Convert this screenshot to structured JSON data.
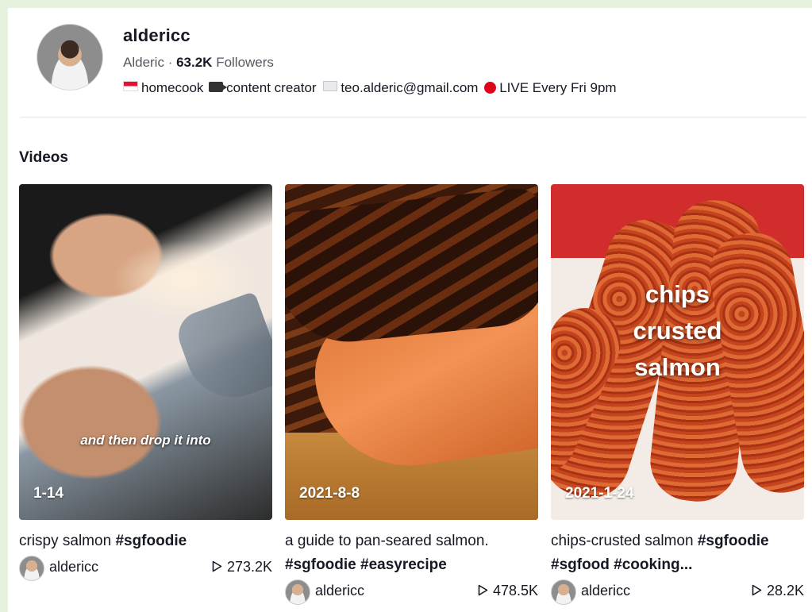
{
  "profile": {
    "username": "aldericc",
    "display_name": "Alderic",
    "separator": " · ",
    "followers_count": "63.2K",
    "followers_label": "Followers",
    "bio": {
      "part1": "homecook",
      "part2": "content creator",
      "part3": "teo.alderic@gmail.com",
      "part4": "LIVE Every Fri 9pm"
    }
  },
  "section_title": "Videos",
  "videos": [
    {
      "date": "1-14",
      "overlay_text": "and then drop it into",
      "title": "crispy salmon",
      "tags": "#sgfoodie",
      "tags2": "",
      "author": "aldericc",
      "views": "273.2K"
    },
    {
      "date": "2021-8-8",
      "overlay_text": "",
      "title": "a guide to pan-seared salmon.",
      "tags": "",
      "tags2": "#sgfoodie #easyrecipe",
      "author": "aldericc",
      "views": "478.5K"
    },
    {
      "date": "2021-1-24",
      "overlay_text": "chips\ncrusted\nsalmon",
      "overlay_line1": "chips",
      "overlay_line2": "crusted",
      "overlay_line3": "salmon",
      "title": "chips-crusted salmon",
      "tags": "#sgfoodie",
      "tags2": "#sgfood #cooking...",
      "author": "aldericc",
      "views": "28.2K"
    }
  ],
  "colors": {
    "page_background": "#e6f2dd",
    "text_primary": "#161823",
    "text_secondary": "#565760",
    "live_dot": "#e3001b"
  },
  "icons": {
    "play": "play-icon",
    "flag": "singapore-flag-icon",
    "camera": "movie-camera-icon",
    "mail": "envelope-icon",
    "live": "red-circle-icon"
  }
}
